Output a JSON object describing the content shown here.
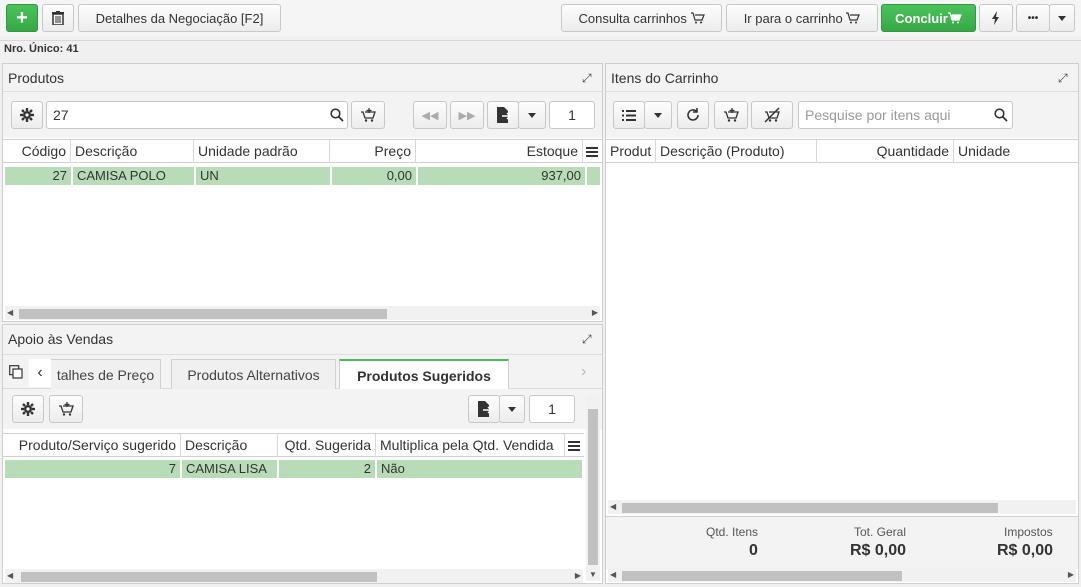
{
  "toolbar": {
    "negotiation_details": "Detalhes da Negociação [F2]",
    "consult_carts": "Consulta carrinhos",
    "go_to_cart": "Ir para o carrinho",
    "finish": "Concluir",
    "more": "•••"
  },
  "nro_unico": "Nro. Único: 41",
  "produtos": {
    "title": "Produtos",
    "search_value": "27",
    "page": "1",
    "columns": [
      "Código",
      "Descrição",
      "Unidade padrão",
      "Preço",
      "Estoque"
    ],
    "rows": [
      {
        "codigo": "27",
        "descricao": "CAMISA POLO",
        "unidade": "UN",
        "preco": "0,00",
        "estoque": "937,00"
      }
    ]
  },
  "carrinho": {
    "title": "Itens do Carrinho",
    "search_placeholder": "Pesquise por itens aqui",
    "columns": [
      "Produt",
      "Descrição (Produto)",
      "Quantidade",
      "Unidade"
    ],
    "summary": {
      "qtd_label": "Qtd. Itens",
      "qtd_value": "0",
      "tot_label": "Tot. Geral",
      "tot_value": "R$ 0,00",
      "imp_label": "Impostos",
      "imp_value": "R$ 0,00"
    }
  },
  "apoio": {
    "title": "Apoio às Vendas",
    "tabs": [
      "talhes de Preço",
      "Produtos Alternativos",
      "Produtos Sugeridos"
    ],
    "active_tab": "Produtos Sugeridos",
    "page": "1",
    "columns": [
      "Produto/Serviço sugerido",
      "Descrição",
      "Qtd. Sugerida",
      "Multiplica pela Qtd. Vendida"
    ],
    "rows": [
      {
        "produto": "7",
        "descricao": "CAMISA LISA",
        "qtd": "2",
        "multiplica": "Não"
      }
    ]
  },
  "colors": {
    "accent_green": "#3cb44b",
    "row_selected": "#b8dcb8"
  }
}
